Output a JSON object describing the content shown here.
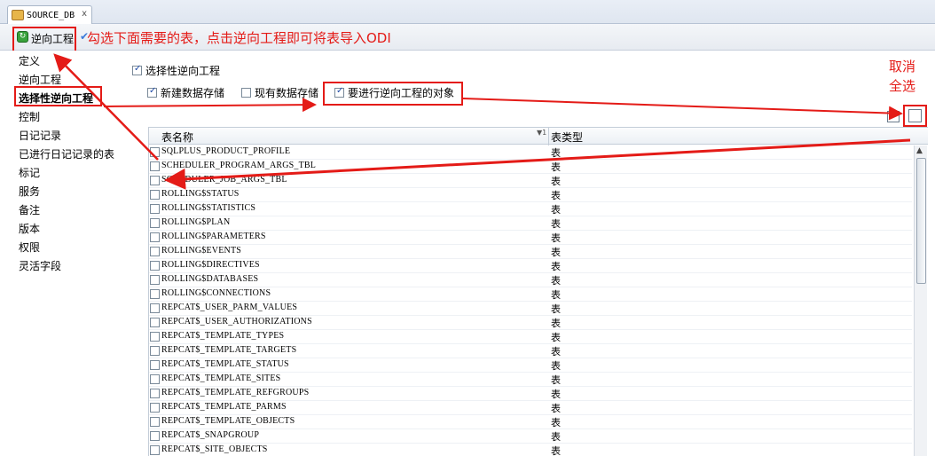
{
  "tab": {
    "label": "SOURCE_DB",
    "close": "x"
  },
  "toolbar": {
    "reverse_btn_label": "逆向工程",
    "instruction": "勾选下面需要的表，点击逆向工程即可将表导入ODI"
  },
  "nav": {
    "items": [
      "定义",
      "逆向工程",
      "选择性逆向工程",
      "控制",
      "日记记录",
      "已进行日记记录的表",
      "标记",
      "服务",
      "备注",
      "版本",
      "权限",
      "灵活字段"
    ],
    "selected_index": 2
  },
  "options": {
    "selective_reverse": {
      "label": "选择性逆向工程",
      "checked": true
    },
    "new_datastores": {
      "label": "新建数据存储",
      "checked": true
    },
    "existing_datastores": {
      "label": "现有数据存储",
      "checked": false
    },
    "objects_to_reverse": {
      "label": "要进行逆向工程的对象",
      "checked": true
    }
  },
  "annotations": {
    "cancel_select_all": [
      "取消",
      "全选"
    ],
    "color": "#e41b17"
  },
  "table": {
    "columns": [
      "表名称",
      "表类型"
    ],
    "sort_indicator": "▼1",
    "rows": [
      {
        "name": "SQLPLUS_PRODUCT_PROFILE",
        "type": "表"
      },
      {
        "name": "SCHEDULER_PROGRAM_ARGS_TBL",
        "type": "表"
      },
      {
        "name": "SCHEDULER_JOB_ARGS_TBL",
        "type": "表"
      },
      {
        "name": "ROLLING$STATUS",
        "type": "表"
      },
      {
        "name": "ROLLING$STATISTICS",
        "type": "表"
      },
      {
        "name": "ROLLING$PLAN",
        "type": "表"
      },
      {
        "name": "ROLLING$PARAMETERS",
        "type": "表"
      },
      {
        "name": "ROLLING$EVENTS",
        "type": "表"
      },
      {
        "name": "ROLLING$DIRECTIVES",
        "type": "表"
      },
      {
        "name": "ROLLING$DATABASES",
        "type": "表"
      },
      {
        "name": "ROLLING$CONNECTIONS",
        "type": "表"
      },
      {
        "name": "REPCAT$_USER_PARM_VALUES",
        "type": "表"
      },
      {
        "name": "REPCAT$_USER_AUTHORIZATIONS",
        "type": "表"
      },
      {
        "name": "REPCAT$_TEMPLATE_TYPES",
        "type": "表"
      },
      {
        "name": "REPCAT$_TEMPLATE_TARGETS",
        "type": "表"
      },
      {
        "name": "REPCAT$_TEMPLATE_STATUS",
        "type": "表"
      },
      {
        "name": "REPCAT$_TEMPLATE_SITES",
        "type": "表"
      },
      {
        "name": "REPCAT$_TEMPLATE_REFGROUPS",
        "type": "表"
      },
      {
        "name": "REPCAT$_TEMPLATE_PARMS",
        "type": "表"
      },
      {
        "name": "REPCAT$_TEMPLATE_OBJECTS",
        "type": "表"
      },
      {
        "name": "REPCAT$_SNAPGROUP",
        "type": "表"
      },
      {
        "name": "REPCAT$_SITE_OBJECTS",
        "type": "表"
      }
    ]
  }
}
